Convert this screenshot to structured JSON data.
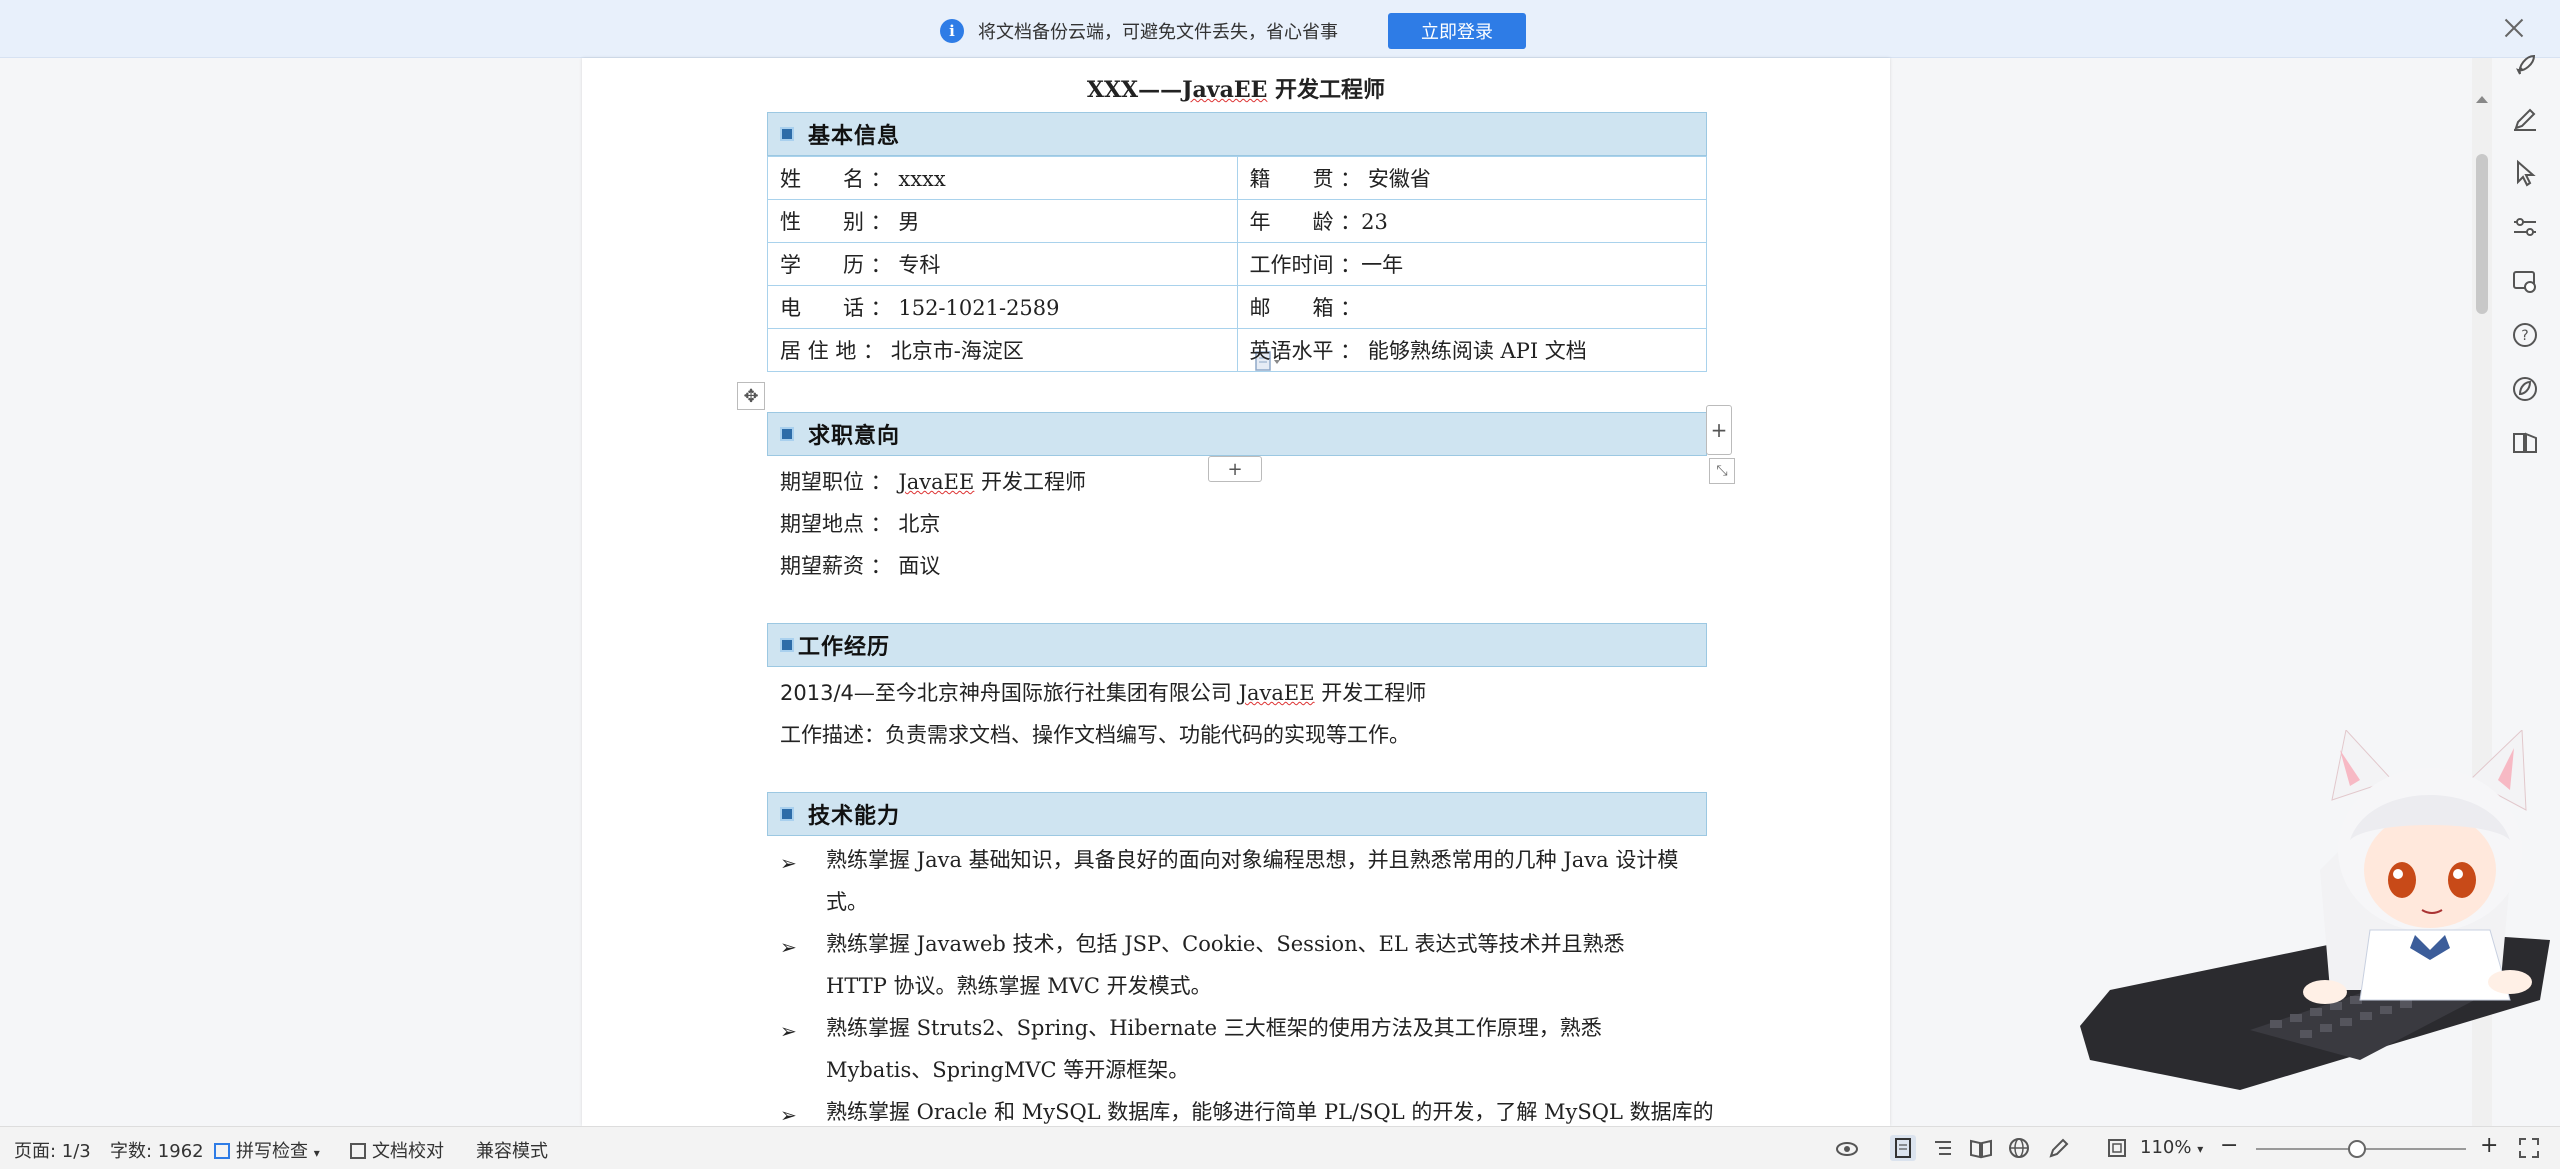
{
  "notice": {
    "text": "将文档备份云端，可避免文件丢失，省心省事",
    "login_label": "立即登录"
  },
  "document": {
    "title_prefix": "XXX——",
    "title_en": "JavaEE",
    "title_suffix": " 开发工程师",
    "sections": {
      "basic": "基本信息",
      "intent": "求职意向",
      "work": "工作经历",
      "skills": "技术能力"
    },
    "basic_info": [
      [
        "姓　　名 ： xxxx",
        "籍　　贯 ： 安徽省"
      ],
      [
        "性　　别 ： 男",
        "年　　龄 ：23"
      ],
      [
        "学　　历 ： 专科",
        "工作时间 ：一年"
      ],
      [
        "电　　话 ： 152-1021-2589",
        "邮　　箱 ："
      ],
      [
        "居 住 地 ： 北京市-海淀区",
        "英语水平 ： 能够熟练阅读 API 文档"
      ]
    ],
    "intent": {
      "position_label": "期望职位 ： ",
      "position_en": "JavaEE",
      "position_rest": " 开发工程师",
      "location": "期望地点 ： 北京",
      "salary": "期望薪资 ： 面议"
    },
    "work": {
      "line1_date": "2013/4",
      "line1_a": "—至今北京神舟国际旅行社集团有限公司 ",
      "line1_en": "JavaEE",
      "line1_b": " 开发工程师",
      "line2": "工作描述：负责需求文档、操作文档编写、功能代码的实现等工作。"
    },
    "skills": [
      "熟练掌握 Java 基础知识，具备良好的面向对象编程思想，并且熟悉常用的几种 Java 设计模式。",
      "熟练掌握 Javaweb 技术，包括 JSP、Cookie、Session、EL 表达式等技术并且熟悉 HTTP 协议。熟练掌握 MVC 开发模式。",
      "熟练掌握 Struts2、Spring、Hibernate 三大框架的使用方法及其工作原理，熟悉 Mybatis、SpringMVC 等开源框架。",
      "熟练掌握 Oracle 和 MySQL 数据库，能够进行简单 PL/SQL 的开发，了解 MySQL 数据库的"
    ],
    "bullet_mark": "➢"
  },
  "status": {
    "page": "页面: 1/3",
    "words": "字数: 1962",
    "spell": "拼写检查",
    "proof": "文档校对",
    "compat": "兼容模式",
    "zoom": "110%"
  },
  "colors": {
    "accent": "#2e7ce6",
    "section_bg": "#cfe4f1",
    "table_border": "#a9d2ec"
  }
}
